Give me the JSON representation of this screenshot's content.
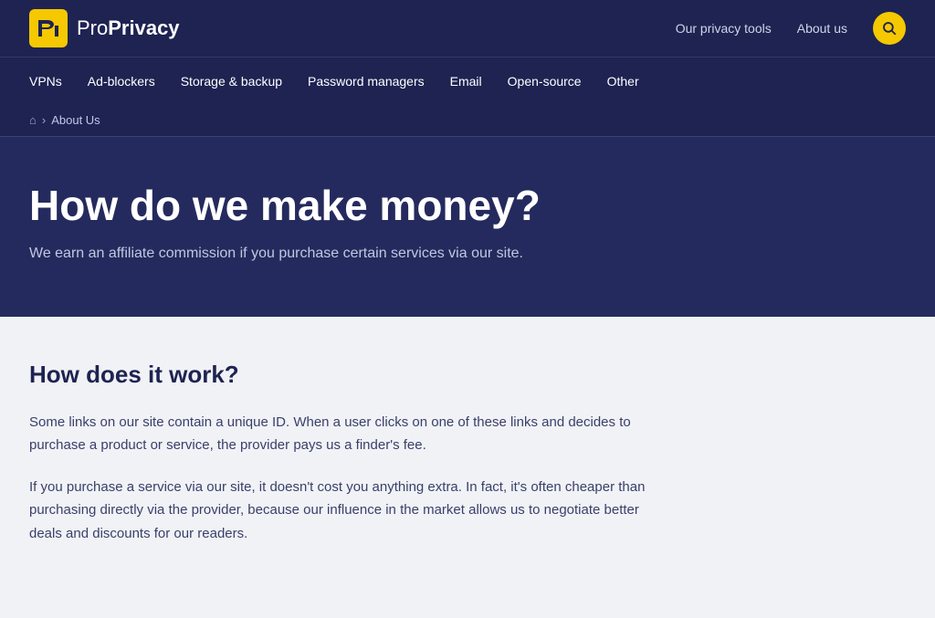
{
  "brand": {
    "logo_text_light": "Pro",
    "logo_text_bold": "Privacy"
  },
  "top_nav": {
    "privacy_tools_label": "Our privacy tools",
    "about_us_label": "About us"
  },
  "main_nav": {
    "items": [
      {
        "label": "VPNs"
      },
      {
        "label": "Ad-blockers"
      },
      {
        "label": "Storage & backup"
      },
      {
        "label": "Password managers"
      },
      {
        "label": "Email"
      },
      {
        "label": "Open-source"
      },
      {
        "label": "Other"
      }
    ]
  },
  "breadcrumb": {
    "about_us": "About Us"
  },
  "hero": {
    "heading": "How do we make money?",
    "subtext": "We earn an affiliate commission if you purchase certain services via our site."
  },
  "content": {
    "section_heading": "How does it work?",
    "paragraph1": "Some links on our site contain a unique ID. When a user clicks on one of these links and decides to purchase a product or service, the provider pays us a finder's fee.",
    "paragraph2": "If you purchase a service via our site, it doesn't cost you anything extra. In fact, it's often cheaper than purchasing directly via the provider, because our influence in the market allows us to negotiate better deals and discounts for our readers."
  }
}
